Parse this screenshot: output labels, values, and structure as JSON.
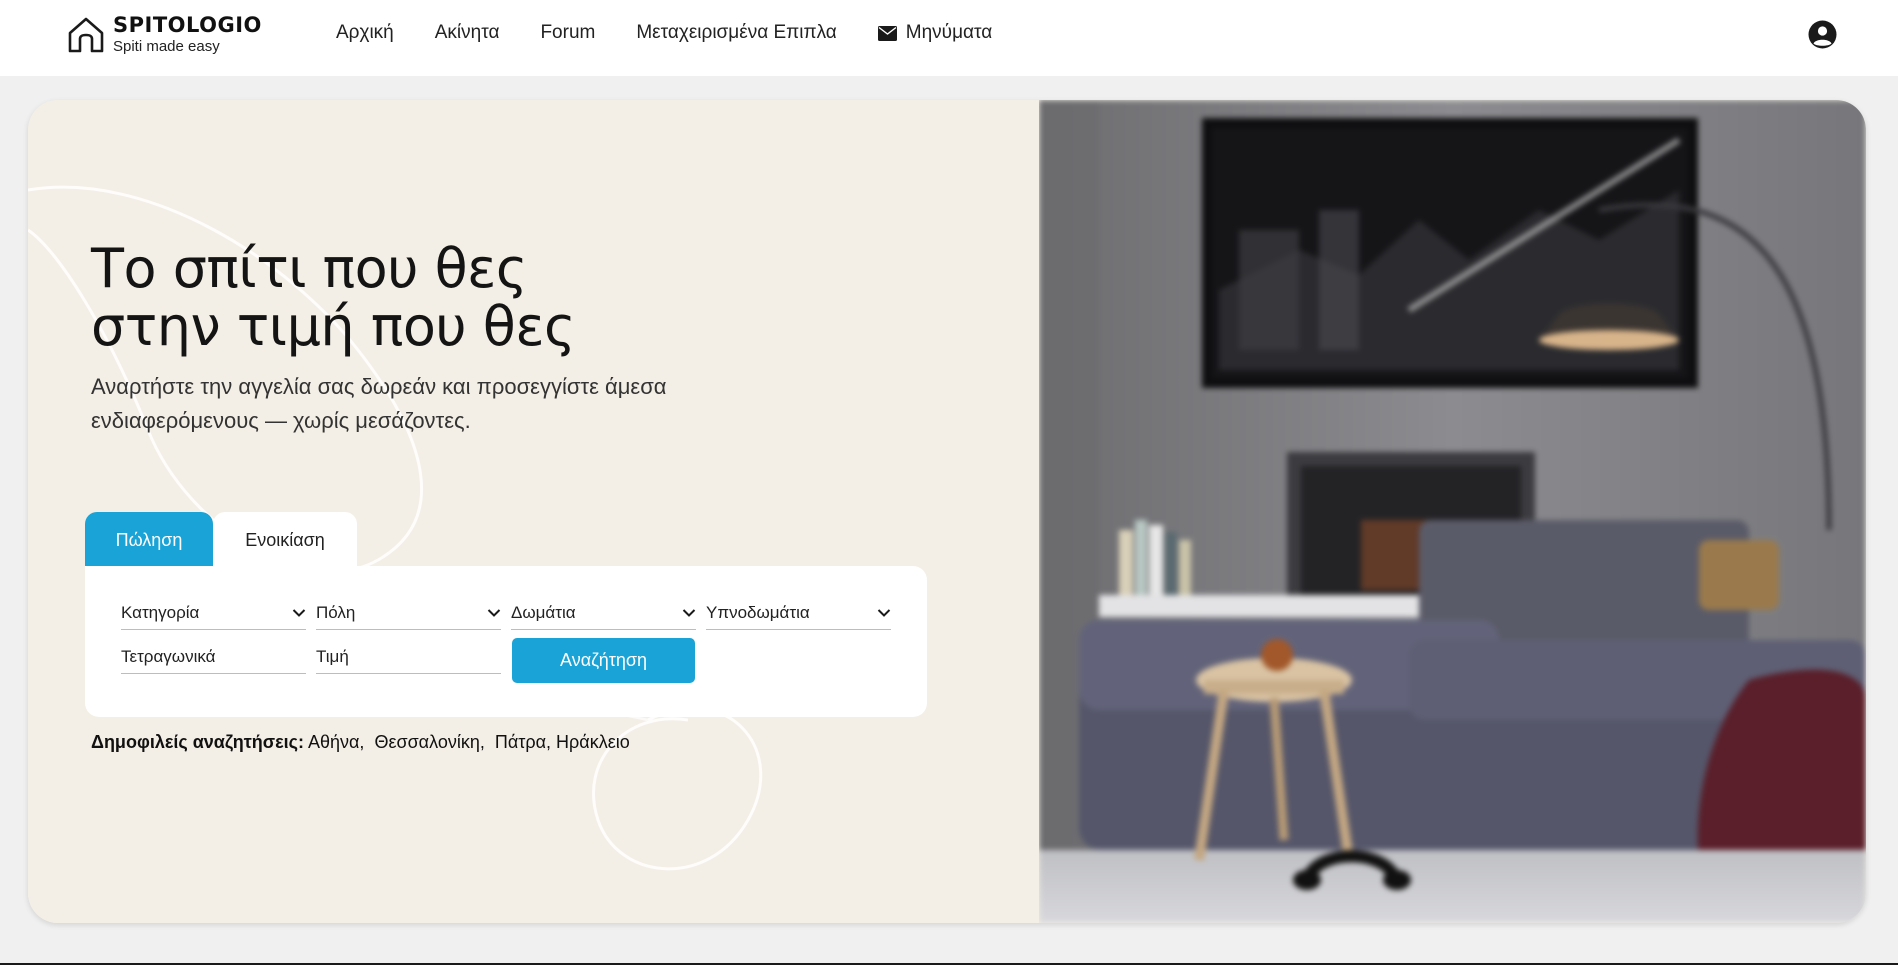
{
  "brand": {
    "name": "SPITOLOGIO",
    "tagline": "Spiti made easy",
    "logo_icon": "house-icon"
  },
  "nav": {
    "items": [
      {
        "label": "Αρχική"
      },
      {
        "label": "Ακίνητα"
      },
      {
        "label": "Forum"
      },
      {
        "label": "Μεταχειρισμένα Επιπλα"
      },
      {
        "label": "Μηνύματα",
        "icon": "envelope-icon"
      }
    ],
    "profile_icon": "user-circle-icon"
  },
  "hero": {
    "headline_line1": "Το σπίτι που θες",
    "headline_line2": "στην τιμή που θες",
    "subline": "Αναρτήστε την αγγελία σας δωρεάν και προσεγγίστε άμεσα ενδιαφερόμενους — χωρίς μεσάζοντες."
  },
  "search": {
    "tabs": [
      {
        "label": "Πώληση",
        "active": true
      },
      {
        "label": "Ενοικίαση",
        "active": false
      }
    ],
    "selects": [
      {
        "value": "Κατηγορία"
      },
      {
        "value": "Πόλη"
      },
      {
        "value": "Δωμάτια"
      },
      {
        "value": "Υπνοδωμάτια"
      }
    ],
    "inputs": [
      {
        "placeholder": "Τετραγωνικά"
      },
      {
        "placeholder": "Τιμή"
      }
    ],
    "button_label": "Αναζήτηση"
  },
  "popular": {
    "label": "Δημοφιλείς αναζητήσεις:",
    "cities": [
      "Αθήνα,",
      "Θεσσαλονίκη,",
      "Πάτρα,",
      "Ηράκλειο"
    ]
  },
  "colors": {
    "accent": "#1aa3d6",
    "hero_bg": "#f3efe6",
    "text": "#1a1a1a"
  }
}
